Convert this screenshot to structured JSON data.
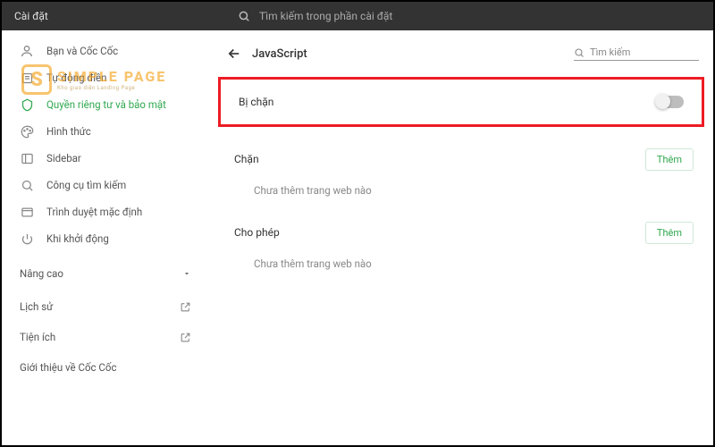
{
  "header": {
    "title": "Cài đặt",
    "search_placeholder": "Tìm kiếm trong phần cài đặt"
  },
  "sidebar": {
    "items": [
      {
        "icon": "user",
        "label": "Bạn và Cốc Cốc"
      },
      {
        "icon": "autofill",
        "label": "Tự động điền"
      },
      {
        "icon": "shield",
        "label": "Quyền riêng tư và bảo mật"
      },
      {
        "icon": "palette",
        "label": "Hình thức"
      },
      {
        "icon": "sidebar",
        "label": "Sidebar"
      },
      {
        "icon": "search",
        "label": "Công cụ tìm kiếm"
      },
      {
        "icon": "browser",
        "label": "Trình duyệt mặc định"
      },
      {
        "icon": "power",
        "label": "Khi khởi động"
      }
    ],
    "advanced": "Nâng cao",
    "sub": [
      {
        "label": "Lịch sử"
      },
      {
        "label": "Tiện ích"
      },
      {
        "label": "Giới thiệu về Cốc Cốc"
      }
    ]
  },
  "page": {
    "title": "JavaScript",
    "search_placeholder": "Tìm kiếm",
    "blocked_label": "Bị chặn",
    "block_section": "Chặn",
    "allow_section": "Cho phép",
    "add_button": "Thêm",
    "empty_text": "Chưa thêm trang web nào"
  },
  "watermark": {
    "brand": "SIMPLE PAGE",
    "tagline": "Kho giao diện Landing Page"
  }
}
